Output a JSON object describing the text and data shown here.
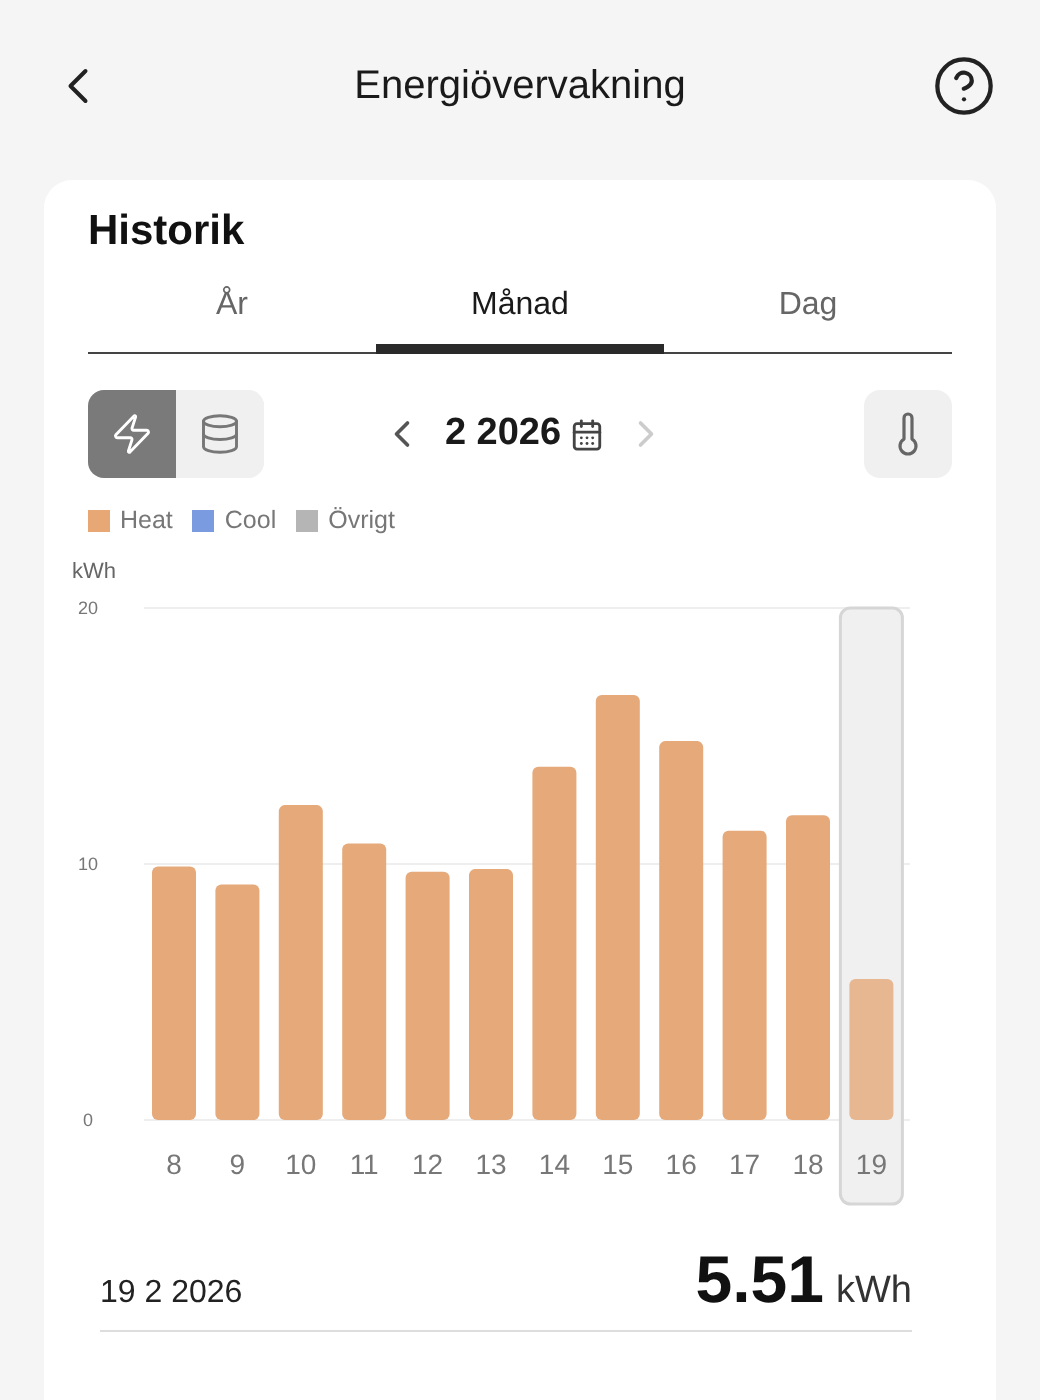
{
  "header": {
    "title": "Energiövervakning"
  },
  "card": {
    "title": "Historik",
    "tabs": [
      {
        "label": "År",
        "selected": false
      },
      {
        "label": "Månad",
        "selected": true
      },
      {
        "label": "Dag",
        "selected": false
      }
    ],
    "modes": [
      {
        "kind": "energy",
        "selected": true
      },
      {
        "kind": "stack",
        "selected": false
      }
    ],
    "period": {
      "label": "2 2026",
      "next_disabled": true,
      "prev_disabled": false
    },
    "legend": [
      {
        "label": "Heat",
        "color": "#e8a876"
      },
      {
        "label": "Cool",
        "color": "#7b9be0"
      },
      {
        "label": "Övrigt",
        "color": "#b5b5b5"
      }
    ],
    "chart_data": {
      "type": "bar",
      "ylabel": "kWh",
      "categories": [
        "8",
        "9",
        "10",
        "11",
        "12",
        "13",
        "14",
        "15",
        "16",
        "17",
        "18",
        "19"
      ],
      "series": [
        {
          "color": "#e5a97a",
          "values": [
            9.9,
            9.2,
            12.3,
            10.8,
            9.7,
            9.8,
            13.8,
            16.6,
            14.8,
            11.3,
            11.9,
            5.51
          ]
        }
      ],
      "ylim": [
        0,
        20
      ],
      "yticks": [
        0,
        10,
        20
      ],
      "bands": [
        {
          "axis": "x",
          "from": "19",
          "to": "19"
        }
      ]
    },
    "summary": {
      "date": "19 2 2026",
      "value": "5.51",
      "unit": "kWh"
    }
  }
}
